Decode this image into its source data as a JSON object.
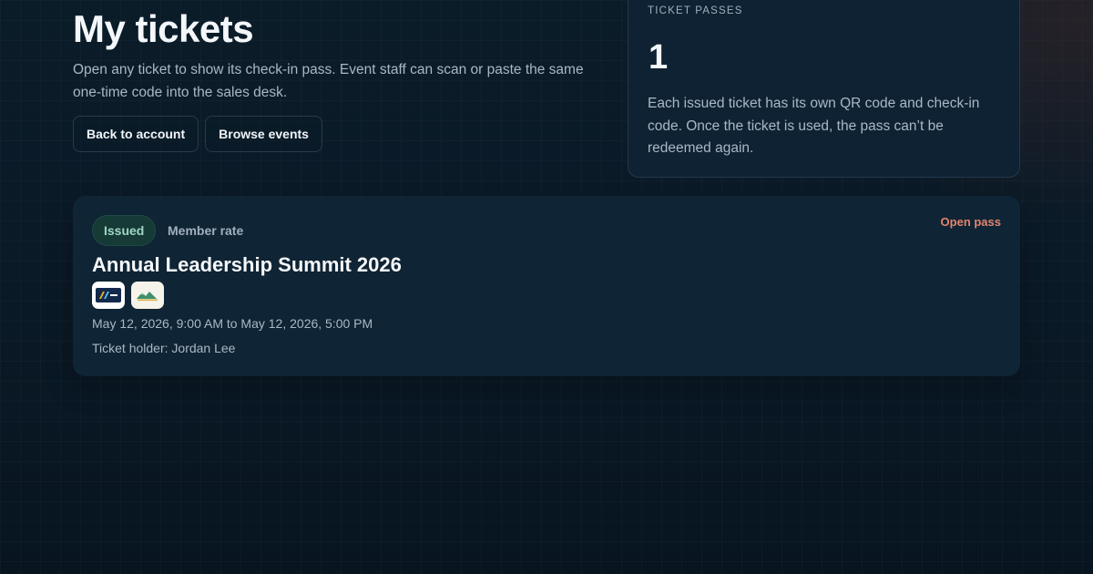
{
  "header": {
    "title": "My tickets",
    "intro": "Open any ticket to show its check-in pass. Event staff can scan or paste the same one-time code into the sales desk.",
    "buttons": {
      "back": "Back to account",
      "browse": "Browse events"
    }
  },
  "stats": {
    "label": "TICKET PASSES",
    "count": "1",
    "description": "Each issued ticket has its own QR code and check-in code. Once the ticket is used, the pass can’t be redeemed again."
  },
  "tickets": [
    {
      "status": "Issued",
      "rate": "Member rate",
      "action": "Open pass",
      "title": "Annual Leadership Summit 2026",
      "logos": [
        "stripes-logo-icon",
        "mountain-logo-icon"
      ],
      "dates": "May 12, 2026, 9:00 AM to May 12, 2026, 5:00 PM",
      "holder": "Ticket holder: Jordan Lee"
    }
  ],
  "colors": {
    "background": "#0a1824",
    "card": "#0f2434",
    "status_issued": "#9fd6c4",
    "accent_link": "#e4846e"
  }
}
